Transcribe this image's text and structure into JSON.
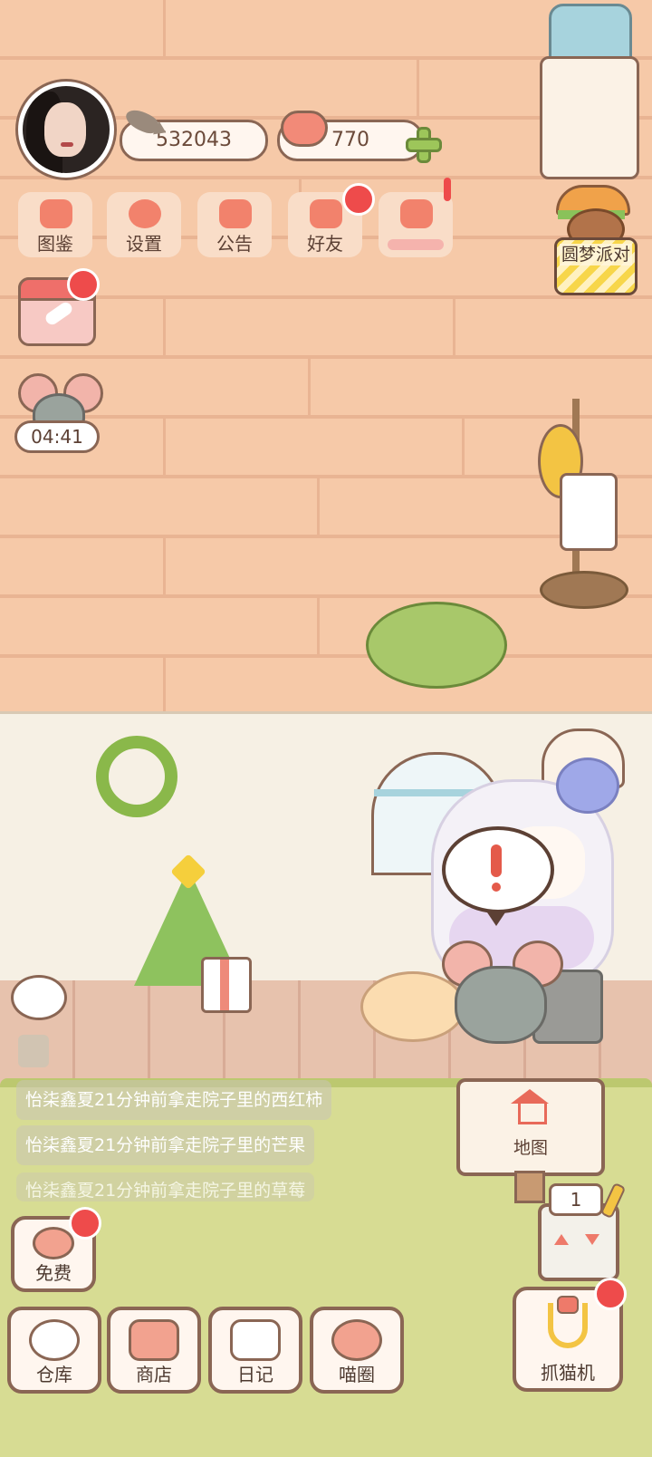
{
  "hud": {
    "fish_count": "532043",
    "heart_count": "770"
  },
  "menu": {
    "items": [
      {
        "label": "图鉴",
        "icon": "cat-book-icon"
      },
      {
        "label": "设置",
        "icon": "gear-icon"
      },
      {
        "label": "公告",
        "icon": "gift-icon"
      },
      {
        "label": "好友",
        "icon": "friends-icon"
      },
      {
        "label": "",
        "icon": "heart-hands-icon"
      }
    ]
  },
  "side": {
    "timer": "04:41",
    "party_label": "圆梦派对"
  },
  "chat": {
    "lines": [
      {
        "prefix": "怡柒鑫夏21分钟前拿走院子里的",
        "item": "西红柿"
      },
      {
        "prefix": "怡柒鑫夏21分钟前拿走院子里的",
        "item": "芒果"
      },
      {
        "prefix": "怡柒鑫夏21分钟前拿走院子里的",
        "item": "草莓"
      }
    ]
  },
  "map_sign": {
    "label": "地图"
  },
  "slot": {
    "count": "1"
  },
  "bottom": {
    "free": "免费",
    "warehouse": "仓库",
    "shop": "商店",
    "diary": "日记",
    "meow_circle": "喵圈",
    "claw_machine": "抓猫机"
  },
  "colors": {
    "wall": "#f6c9a8",
    "grass": "#d7dc93",
    "accent_red": "#ee4b4b",
    "border_brown": "#8a6654"
  }
}
